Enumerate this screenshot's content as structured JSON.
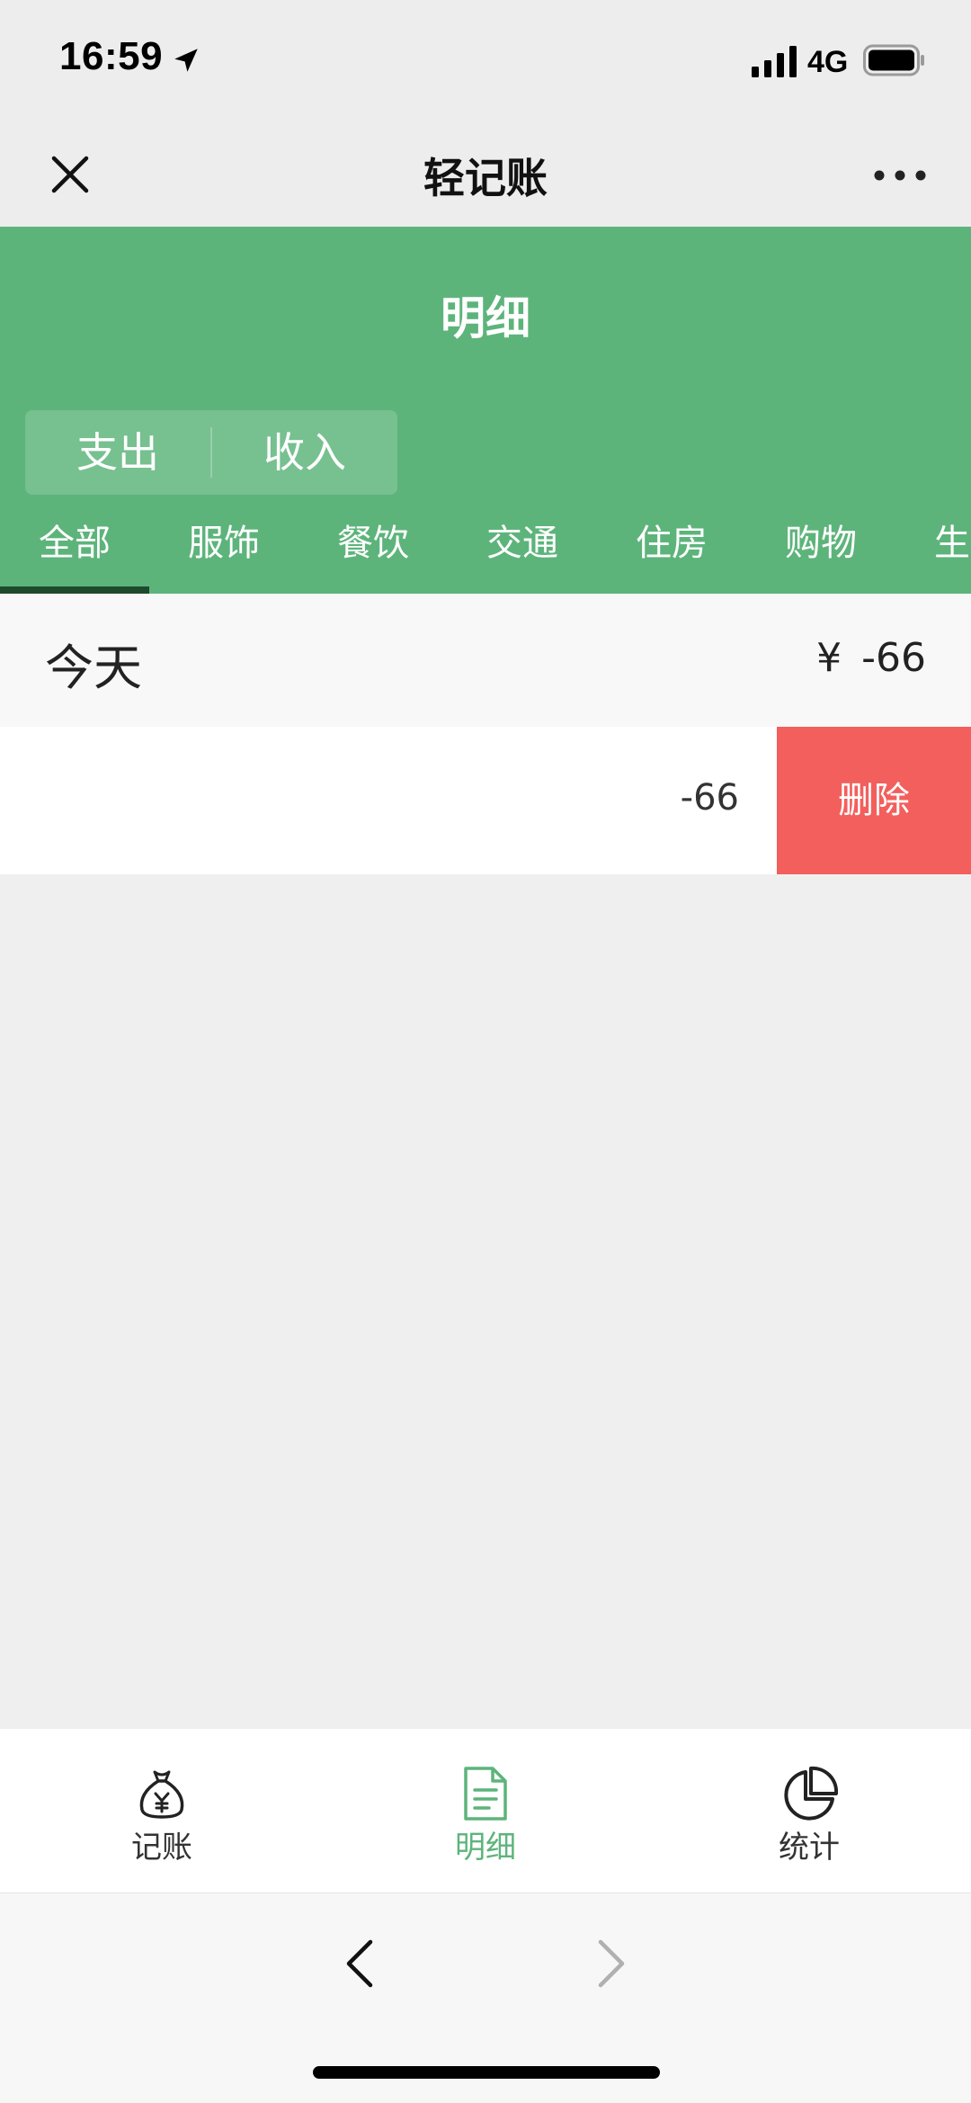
{
  "status_bar": {
    "time": "16:59",
    "network": "4G"
  },
  "nav": {
    "title": "轻记账"
  },
  "header": {
    "title": "明细",
    "type_toggle": [
      "支出",
      "收入"
    ],
    "categories": [
      "全部",
      "服饰",
      "餐饮",
      "交通",
      "住房",
      "购物",
      "生活"
    ],
    "active_category": "全部"
  },
  "list": {
    "day_label": "今天",
    "day_total_currency": "¥",
    "day_total_amount": "-66",
    "records": [
      {
        "amount": "-66",
        "delete_label": "删除"
      }
    ]
  },
  "tab_bar": {
    "items": [
      {
        "label": "记账",
        "icon": "money-bag-icon"
      },
      {
        "label": "明细",
        "icon": "document-icon"
      },
      {
        "label": "统计",
        "icon": "pie-chart-icon"
      }
    ],
    "active": "明细"
  },
  "colors": {
    "brand_green": "#5db47b",
    "delete_red": "#f25f5c"
  }
}
